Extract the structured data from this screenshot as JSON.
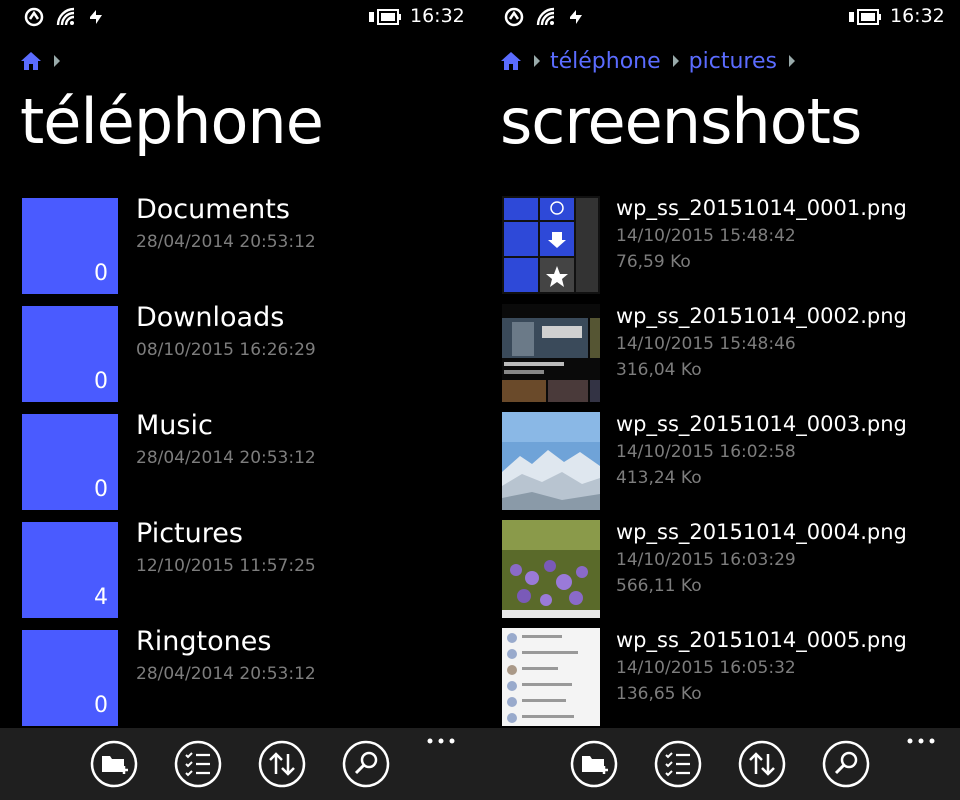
{
  "status": {
    "time": "16:32"
  },
  "left": {
    "breadcrumb": [],
    "title": "téléphone",
    "folders": [
      {
        "name": "Documents",
        "date": "28/04/2014 20:53:12",
        "count": "0"
      },
      {
        "name": "Downloads",
        "date": "08/10/2015 16:26:29",
        "count": "0"
      },
      {
        "name": "Music",
        "date": "28/04/2014 20:53:12",
        "count": "0"
      },
      {
        "name": "Pictures",
        "date": "12/10/2015 11:57:25",
        "count": "4"
      },
      {
        "name": "Ringtones",
        "date": "28/04/2014 20:53:12",
        "count": "0"
      }
    ]
  },
  "right": {
    "breadcrumb": [
      "téléphone",
      "pictures"
    ],
    "title": "screenshots",
    "files": [
      {
        "name": "wp_ss_20151014_0001.png",
        "date": "14/10/2015 15:48:42",
        "size": "76,59 Ko"
      },
      {
        "name": "wp_ss_20151014_0002.png",
        "date": "14/10/2015 15:48:46",
        "size": "316,04 Ko"
      },
      {
        "name": "wp_ss_20151014_0003.png",
        "date": "14/10/2015 16:02:58",
        "size": "413,24 Ko"
      },
      {
        "name": "wp_ss_20151014_0004.png",
        "date": "14/10/2015 16:03:29",
        "size": "566,11 Ko"
      },
      {
        "name": "wp_ss_20151014_0005.png",
        "date": "14/10/2015 16:05:32",
        "size": "136,65 Ko"
      }
    ]
  },
  "appbar": {
    "buttons": [
      "new-folder-icon",
      "select-list-icon",
      "sort-icon",
      "search-icon"
    ],
    "more": "more-icon"
  },
  "colors": {
    "accent": "#4a5bff",
    "link": "#5b6cff",
    "secondary_text": "#7d7d7d",
    "appbar": "#1f1f1f"
  }
}
